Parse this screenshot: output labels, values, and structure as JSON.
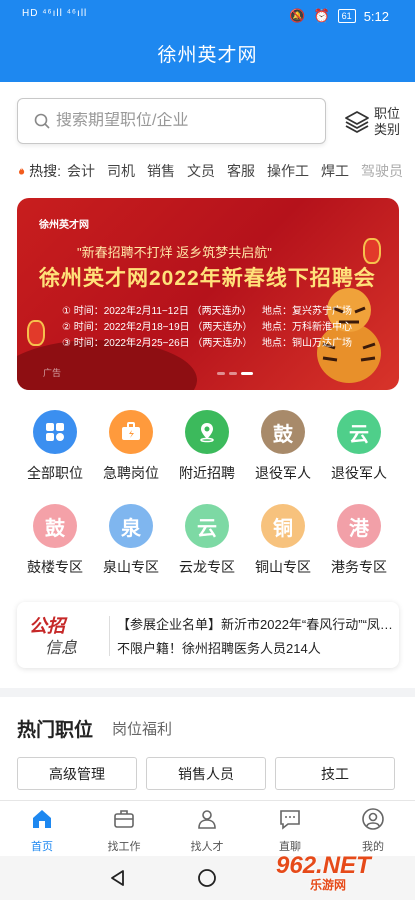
{
  "status": {
    "signal": "HD ⁴⁶ıll ⁴⁶ıll",
    "battery": "61",
    "time": "5:12"
  },
  "header": {
    "title": "徐州英才网"
  },
  "search": {
    "placeholder": "搜索期望职位/企业"
  },
  "category_button": {
    "label": "职位类别"
  },
  "hot_search": {
    "label": "热搜:",
    "keywords": [
      "会计",
      "司机",
      "销售",
      "文员",
      "客服",
      "操作工",
      "焊工",
      "驾驶员"
    ]
  },
  "banner": {
    "logo": "徐州英才网",
    "slogan": "\"新春招聘不打烊 返乡筑梦共启航\"",
    "title": "徐州英才网2022年新春线下招聘会",
    "rows": [
      {
        "time": "① 时间：2022年2月11−12日 （两天连办）",
        "loc": "地点：复兴苏宁广场"
      },
      {
        "time": "② 时间：2022年2月18−19日 （两天连办）",
        "loc": "地点：万科新淮中心"
      },
      {
        "time": "③ 时间：2022年2月25−26日 （两天连办）",
        "loc": "地点：铜山万达广场"
      }
    ],
    "ad_label": "广告"
  },
  "grid": [
    {
      "label": "全部职位",
      "glyph": "",
      "color": "#3b8ff0",
      "icon": "grid-icon"
    },
    {
      "label": "急聘岗位",
      "glyph": "",
      "color": "#ff9a3c",
      "icon": "briefcase-bolt-icon"
    },
    {
      "label": "附近招聘",
      "glyph": "",
      "color": "#3cba5c",
      "icon": "location-pin-icon"
    },
    {
      "label": "退役军人",
      "glyph": "鼓",
      "color": "#a88a6a",
      "icon": ""
    },
    {
      "label": "退役军人",
      "glyph": "云",
      "color": "#4fcf8a",
      "icon": ""
    },
    {
      "label": "鼓楼专区",
      "glyph": "鼓",
      "color": "#f4a1a8",
      "icon": ""
    },
    {
      "label": "泉山专区",
      "glyph": "泉",
      "color": "#7fb6ef",
      "icon": ""
    },
    {
      "label": "云龙专区",
      "glyph": "云",
      "color": "#7dd9a4",
      "icon": ""
    },
    {
      "label": "铜山专区",
      "glyph": "铜",
      "color": "#f7c27d",
      "icon": ""
    },
    {
      "label": "港务专区",
      "glyph": "港",
      "color": "#f2a0a8",
      "icon": ""
    }
  ],
  "notice": {
    "logo_top": "公招",
    "logo_bottom": "信息",
    "line1": "【参展企业名单】新沂市2022年“春风行动”“凤…",
    "line2": "不限户籍！徐州招聘医务人员214人"
  },
  "hot_jobs": {
    "tab_main": "热门职位",
    "tab_sub": "岗位福利",
    "buttons": [
      "高级管理",
      "销售人员",
      "技工"
    ]
  },
  "bottom_nav": [
    {
      "label": "首页",
      "icon": "home-icon",
      "active": true
    },
    {
      "label": "找工作",
      "icon": "briefcase-icon",
      "active": false
    },
    {
      "label": "找人才",
      "icon": "people-icon",
      "active": false
    },
    {
      "label": "直聊",
      "icon": "chat-icon",
      "active": false
    },
    {
      "label": "我的",
      "icon": "user-icon",
      "active": false
    }
  ],
  "watermark": {
    "main": "962.NET",
    "sub": "乐游网"
  },
  "colors": {
    "primary": "#1e88f0",
    "banner_red": "#c81e1e",
    "accent_red": "#c62828"
  }
}
